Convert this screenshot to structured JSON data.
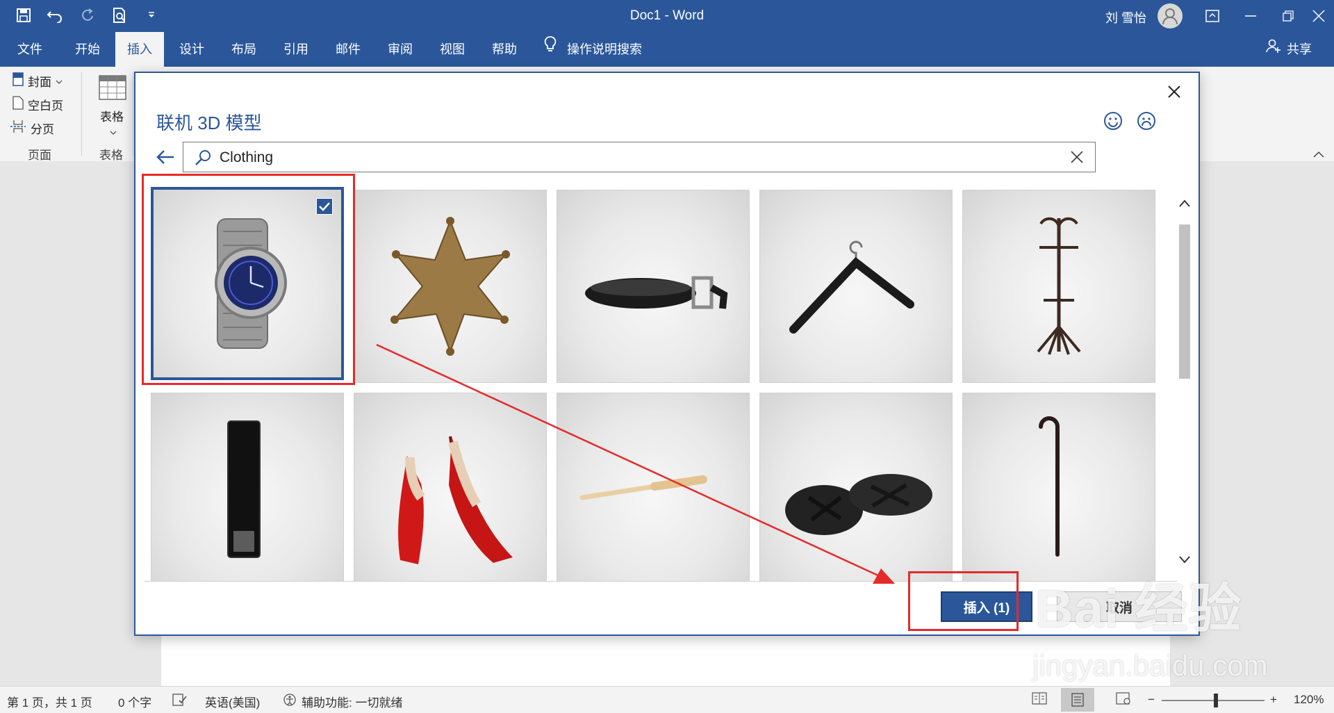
{
  "window": {
    "title": "Doc1  -  Word",
    "user_name": "刘 雪怡",
    "accent_color": "#2b579a"
  },
  "quick_access": {
    "icons": [
      "save-icon",
      "undo-icon",
      "redo-icon",
      "print-preview-icon",
      "customize-qat-icon"
    ]
  },
  "ribbon": {
    "tabs": [
      "文件",
      "开始",
      "插入",
      "设计",
      "布局",
      "引用",
      "邮件",
      "审阅",
      "视图",
      "帮助"
    ],
    "active_tab": "插入",
    "tell_me": "操作说明搜索",
    "share": "共享",
    "pages_group": {
      "items": [
        "封面",
        "空白页",
        "分页"
      ],
      "label": "页面"
    },
    "table_group": {
      "button": "表格",
      "label": "表格"
    }
  },
  "dialog": {
    "title": "联机 3D 模型",
    "search_value": "Clothing",
    "items": [
      {
        "name": "watch",
        "selected": true
      },
      {
        "name": "sheriff-star-badge",
        "selected": false
      },
      {
        "name": "belt",
        "selected": false
      },
      {
        "name": "clothes-hanger",
        "selected": false
      },
      {
        "name": "coat-rack",
        "selected": false
      },
      {
        "name": "mirror",
        "selected": false
      },
      {
        "name": "red-high-heels",
        "selected": false
      },
      {
        "name": "baseball-bat",
        "selected": false
      },
      {
        "name": "sandals",
        "selected": false
      },
      {
        "name": "walking-cane",
        "selected": false
      }
    ],
    "insert_label": "插入 (1)",
    "cancel_label": "取消"
  },
  "statusbar": {
    "page_info": "第 1 页，共 1 页",
    "word_count": "0 个字",
    "language": "英语(美国)",
    "accessibility": "辅助功能: 一切就绪",
    "zoom_level": "120%"
  },
  "watermark": {
    "brand": "Bai 经验",
    "url": "jingyan.baidu.com"
  }
}
